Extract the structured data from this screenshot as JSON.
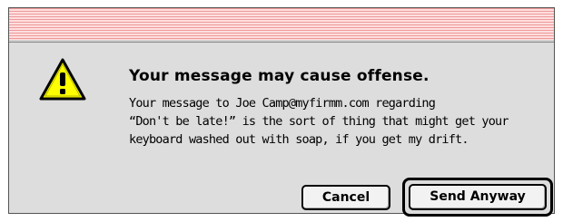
{
  "dialog": {
    "title": "Your message may cause offense.",
    "message_lines": [
      "Your message to Joe Camp@myfirmm.com regarding",
      "“Don't be late!” is the sort of thing that might get your",
      "keyboard washed out with soap, if you get my drift."
    ],
    "icon": "caution-triangle-icon",
    "buttons": {
      "cancel_label": "Cancel",
      "send_label": "Send Anyway"
    }
  },
  "colors": {
    "titlebar_stripe": "#ee9999",
    "titlebar_background": "#ffdede",
    "dialog_background": "#dddddd",
    "icon_fill": "#ffff00"
  }
}
